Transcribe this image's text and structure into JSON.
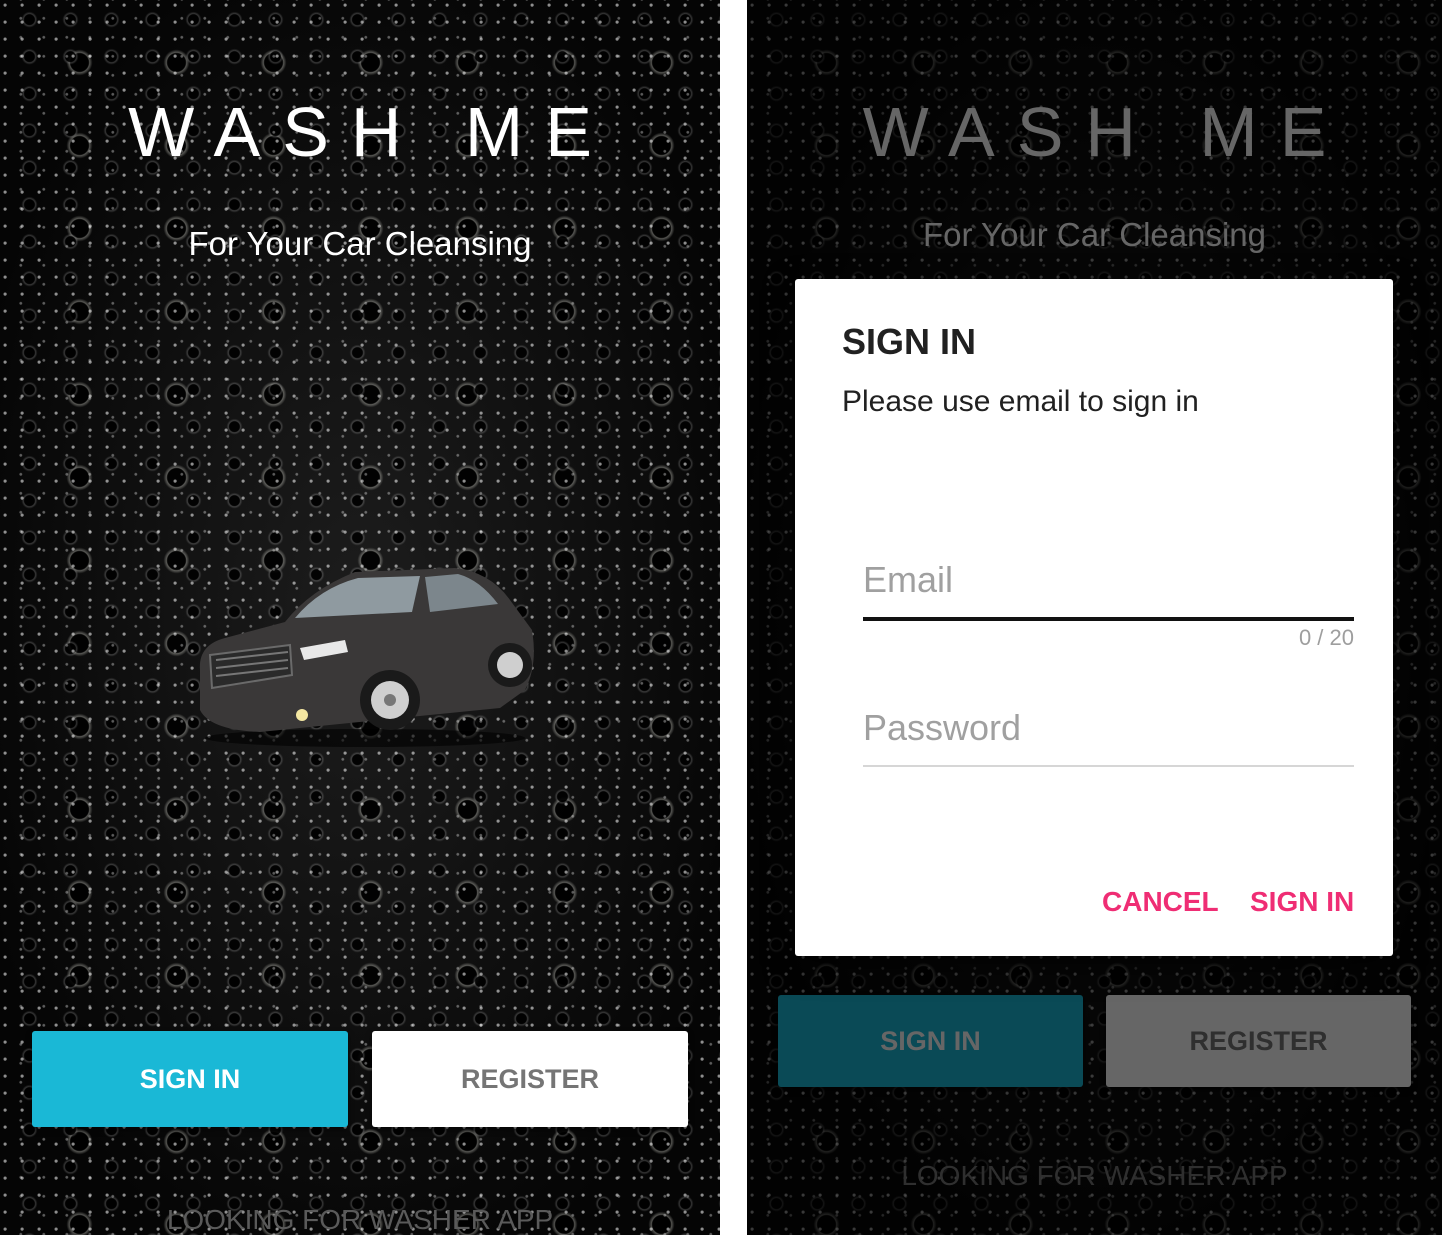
{
  "app": {
    "title": "WASH ME",
    "subtitle": "For Your Car Cleansing"
  },
  "buttons": {
    "sign_in": "SIGN IN",
    "register": "REGISTER"
  },
  "footer_link": "LOOKING FOR WASHER APP",
  "dialog": {
    "title": "SIGN IN",
    "message": "Please use email to sign in",
    "email_placeholder": "Email",
    "email_counter": "0 / 20",
    "password_placeholder": "Password",
    "cancel_label": "CANCEL",
    "confirm_label": "SIGN IN"
  },
  "colors": {
    "primary_button": "#1ab8d6",
    "dialog_action": "#ef2d74"
  }
}
